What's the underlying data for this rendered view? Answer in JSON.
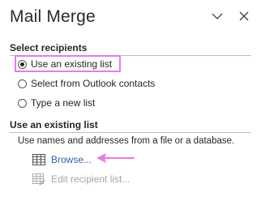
{
  "pane": {
    "title": "Mail Merge",
    "options_icon": "chevron-down-icon",
    "close_icon": "close-icon"
  },
  "select_recipients": {
    "heading": "Select recipients",
    "options": [
      {
        "label": "Use an existing list",
        "selected": true
      },
      {
        "label": "Select from Outlook contacts",
        "selected": false
      },
      {
        "label": "Type a new list",
        "selected": false
      }
    ]
  },
  "existing_list": {
    "heading": "Use an existing list",
    "description": "Use names and addresses from a file or a database.",
    "browse_label": "Browse...",
    "edit_label": "Edit recipient list...",
    "browse_icon": "table-icon",
    "edit_icon": "edit-table-icon"
  },
  "colors": {
    "highlight": "#ea7be6",
    "link": "#2f5fa8",
    "disabled": "#a6a6a6"
  }
}
